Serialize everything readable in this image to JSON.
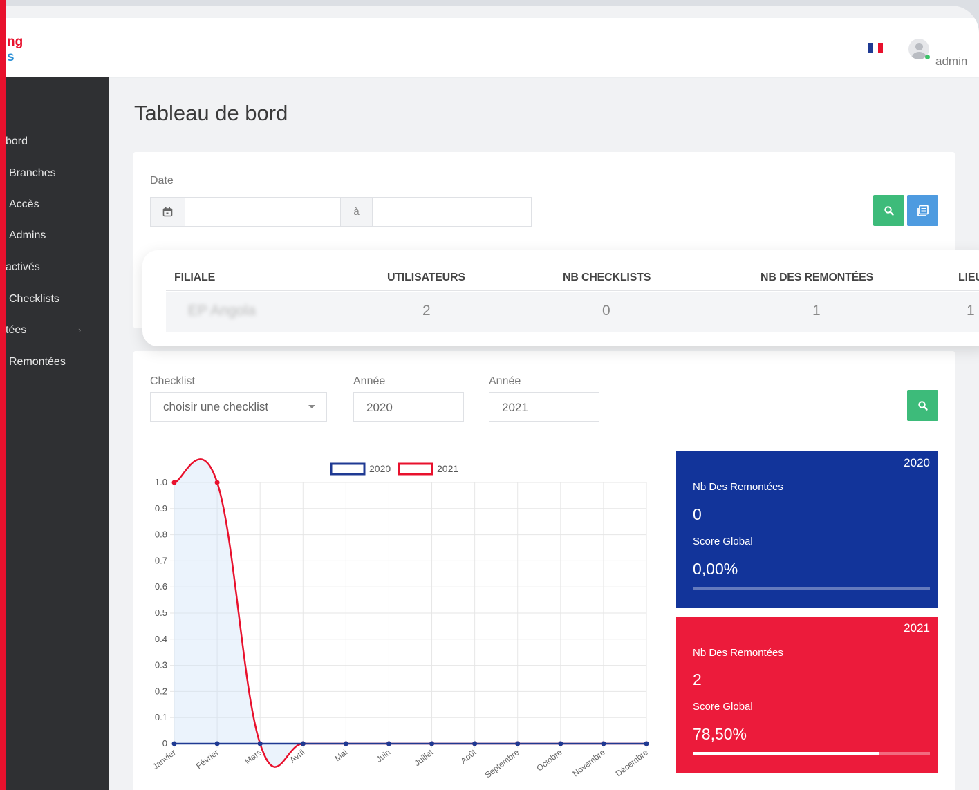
{
  "brand": {
    "line1": "ng",
    "line2": "s"
  },
  "header": {
    "username": "admin",
    "flag_colors": [
      "#1f3a93",
      "#ffffff",
      "#e8112d"
    ],
    "flag_icon": "france-flag-icon"
  },
  "sidebar": {
    "items": [
      {
        "label": "bord"
      },
      {
        "label": "Branches"
      },
      {
        "label": "Accès"
      },
      {
        "label": "Admins"
      },
      {
        "label": "activés"
      },
      {
        "label": "Checklists"
      },
      {
        "label": "tées",
        "has_submenu": true
      },
      {
        "label": "Remontées"
      }
    ],
    "chevron": "›"
  },
  "page": {
    "title": "Tableau de bord"
  },
  "date_filter": {
    "label": "Date",
    "separator": "à",
    "from_value": "",
    "to_value": "",
    "calendar_icon": "calendar-icon",
    "search_icon": "search-icon",
    "export_icon": "export-icon"
  },
  "table": {
    "headers": [
      "FILIALE",
      "UTILISATEURS",
      "NB CHECKLISTS",
      "NB DES REMONTÉES",
      "LIEU"
    ],
    "rows": [
      {
        "filiale": "EP Angola",
        "utilisateurs": "2",
        "nb_checklists": "0",
        "nb_remontees": "1",
        "lieu": "1"
      }
    ]
  },
  "chart_filter": {
    "checklist_label": "Checklist",
    "checklist_placeholder": "choisir une checklist",
    "year1_label": "Année",
    "year1_value": "2020",
    "year2_label": "Année",
    "year2_value": "2021"
  },
  "chart_data": {
    "type": "line",
    "categories": [
      "Janvier",
      "Février",
      "Mars",
      "Avril",
      "Mai",
      "Juin",
      "Juillet",
      "Août",
      "Septembre",
      "Octobre",
      "Novembre",
      "Décembre"
    ],
    "series": [
      {
        "name": "2020",
        "color": "#1f3a93",
        "values": [
          0,
          0,
          0,
          0,
          0,
          0,
          0,
          0,
          0,
          0,
          0,
          0
        ]
      },
      {
        "name": "2021",
        "color": "#e8112d",
        "values": [
          1,
          1,
          0,
          0,
          0,
          0,
          0,
          0,
          0,
          0,
          0,
          0
        ]
      }
    ],
    "ylim": [
      0,
      1
    ],
    "yticks": [
      "0",
      "0.1",
      "0.2",
      "0.3",
      "0.4",
      "0.5",
      "0.6",
      "0.7",
      "0.8",
      "0.9",
      "1.0"
    ],
    "grid": true,
    "legend": "top"
  },
  "stats": [
    {
      "year": "2020",
      "label_count": "Nb Des Remontées",
      "count": "0",
      "label_score": "Score Global",
      "score": "0,00%",
      "progress": 0,
      "color": "#12349a"
    },
    {
      "year": "2021",
      "label_count": "Nb Des Remontées",
      "count": "2",
      "label_score": "Score Global",
      "score": "78,50%",
      "progress": 0.785,
      "color": "#ec1b3b"
    }
  ]
}
